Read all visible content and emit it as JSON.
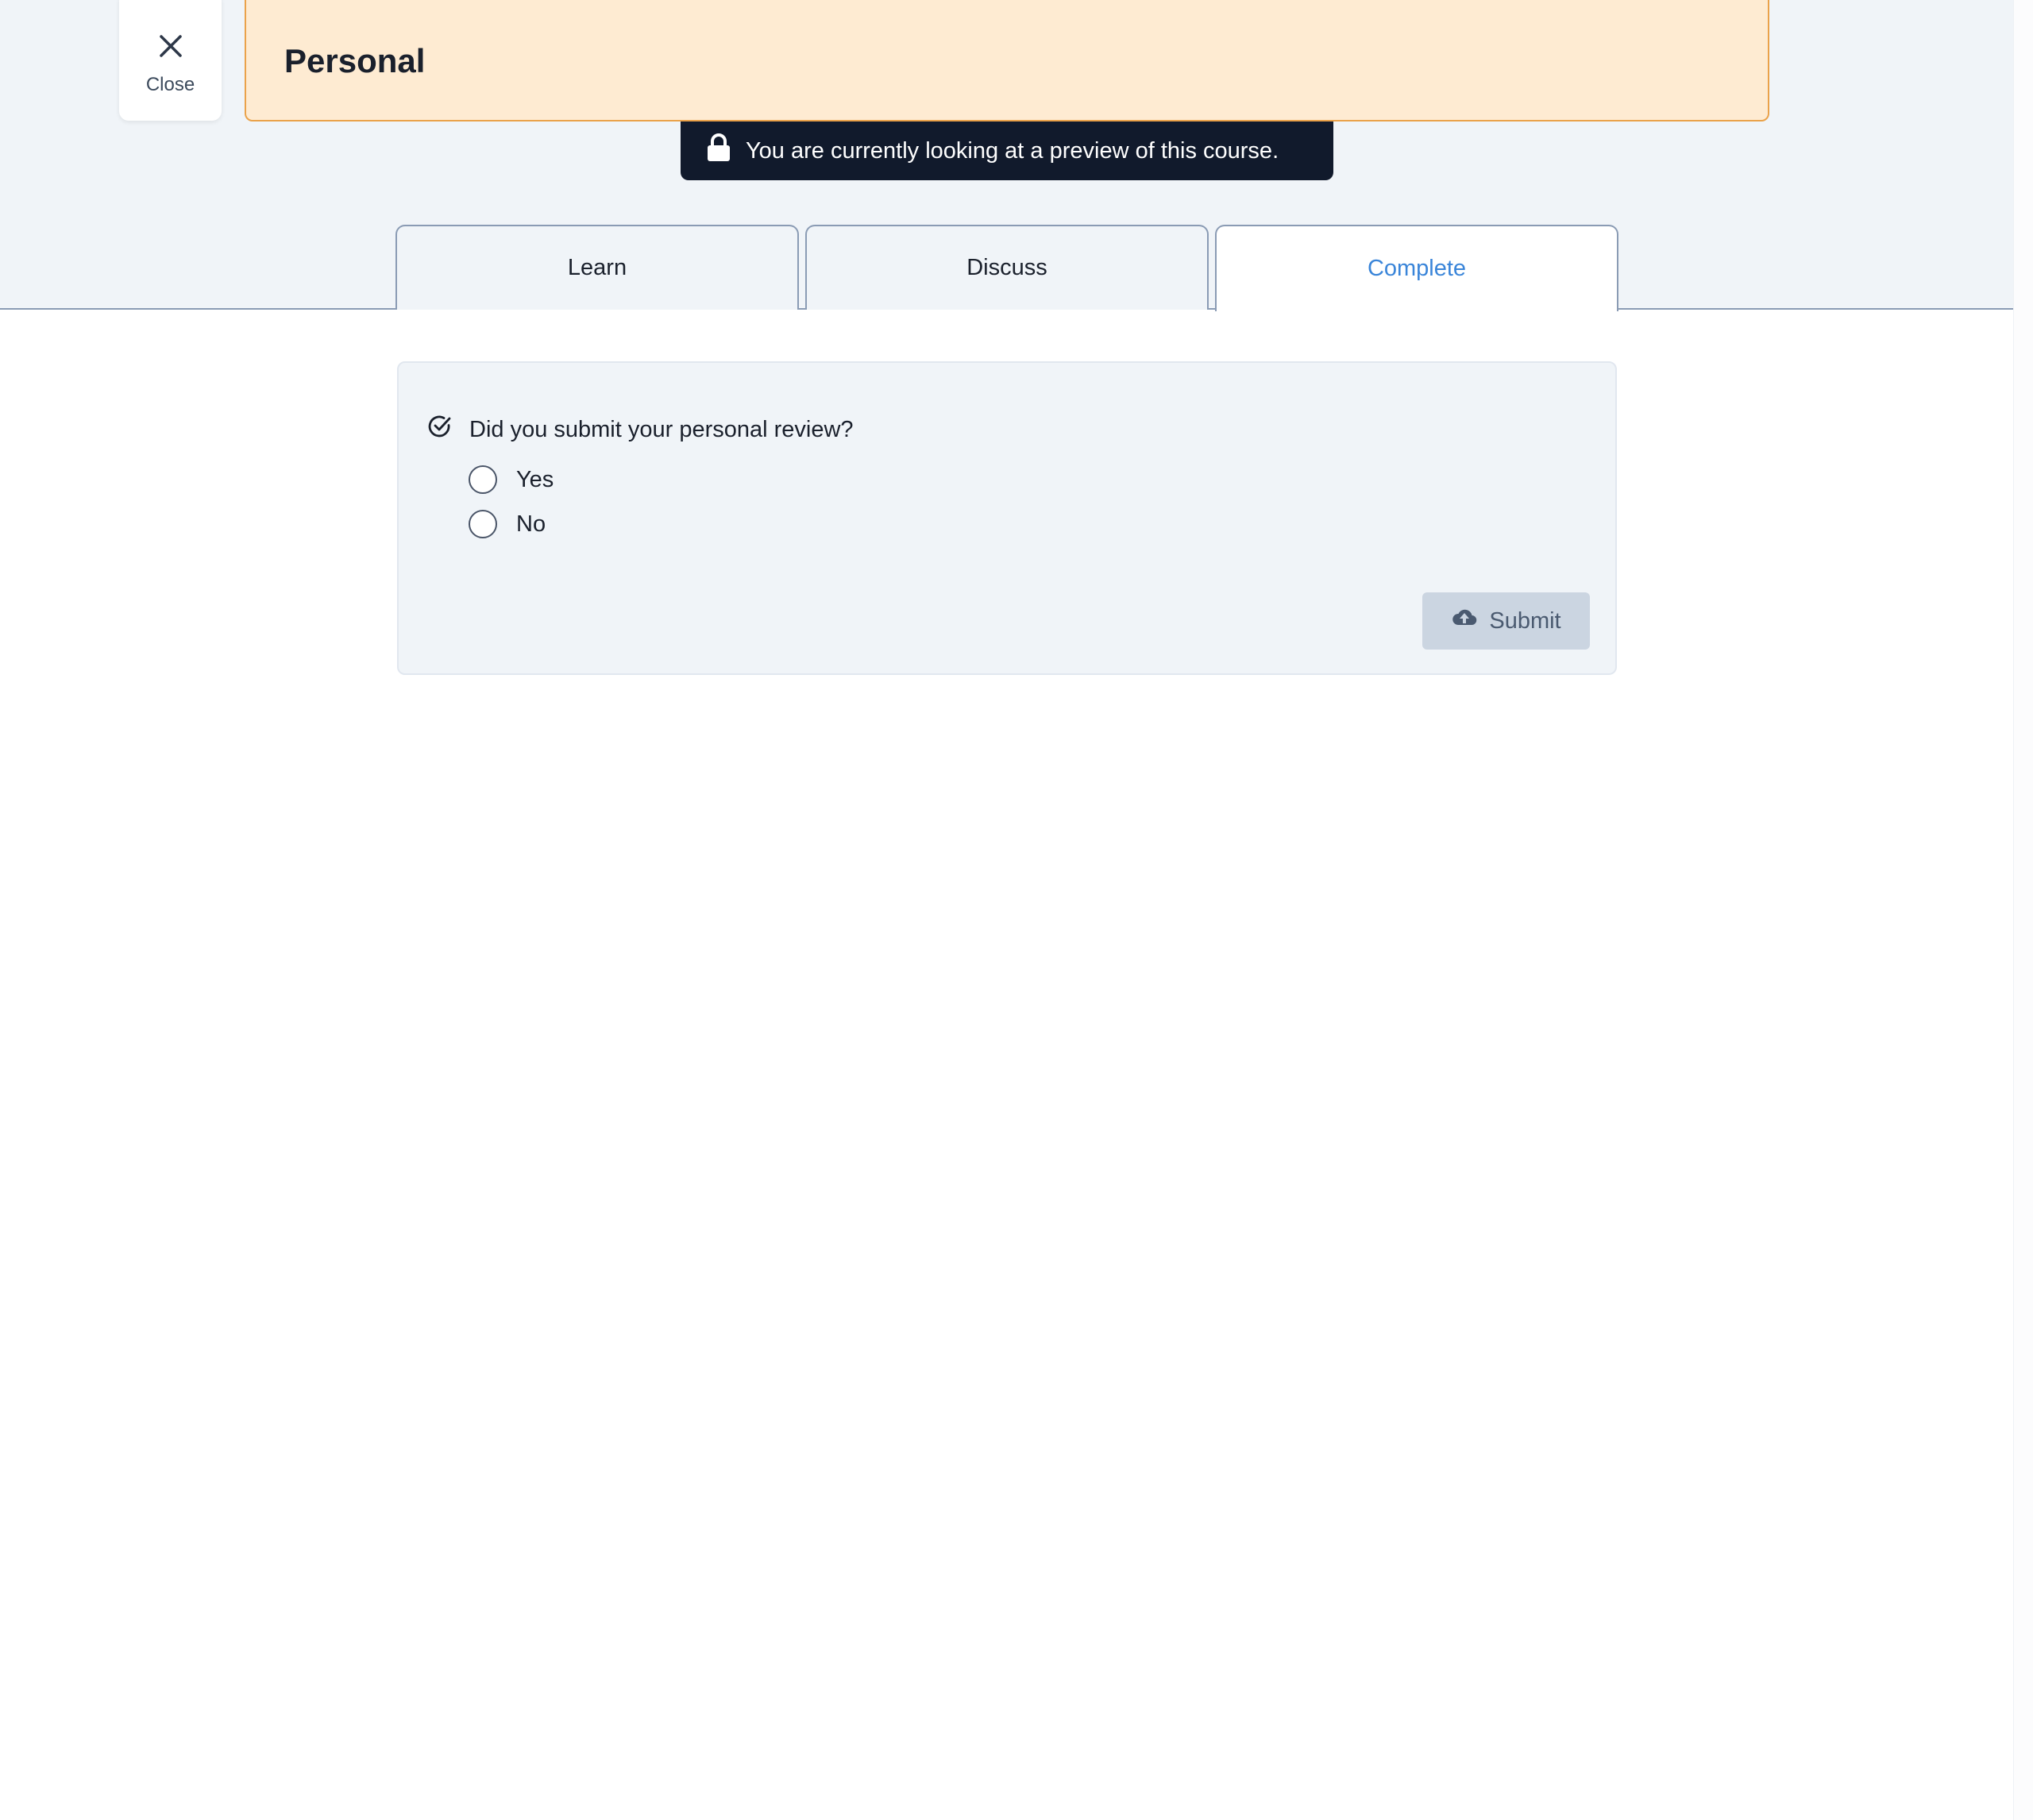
{
  "close": {
    "label": "Close",
    "icon": "close-icon"
  },
  "header": {
    "title": "Personal",
    "banner_color": "#feebd2",
    "banner_border": "#eaa24a"
  },
  "preview_notice": {
    "text": "You are currently looking at a preview of this course.",
    "icon": "lock-icon"
  },
  "tabs": [
    {
      "label": "Learn",
      "active": false
    },
    {
      "label": "Discuss",
      "active": false
    },
    {
      "label": "Complete",
      "active": true
    }
  ],
  "colors": {
    "active_tab": "#3a85d9",
    "notice_bg": "#111a2c"
  },
  "completion_form": {
    "question": "Did you submit your personal review?",
    "question_icon": "check-circle-icon",
    "options": [
      {
        "label": "Yes",
        "selected": false
      },
      {
        "label": "No",
        "selected": false
      }
    ],
    "submit_label": "Submit",
    "submit_icon": "cloud-upload-icon",
    "submit_enabled": false
  }
}
